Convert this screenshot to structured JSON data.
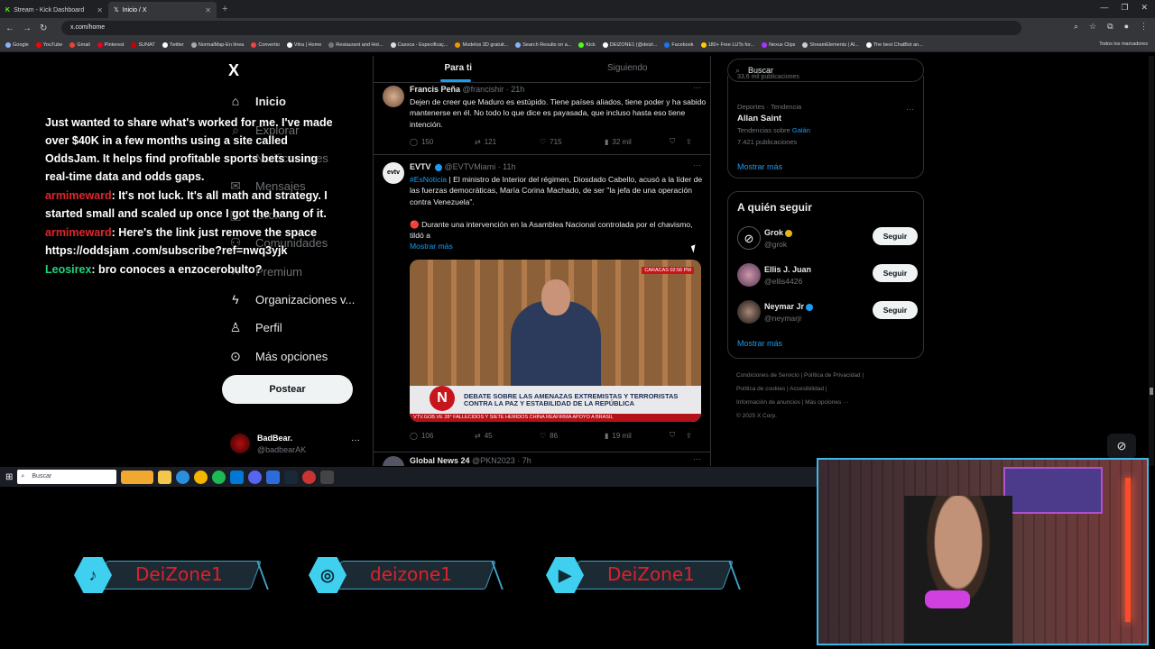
{
  "browser": {
    "tabs": [
      {
        "label": "Stream - Kick Dashboard"
      },
      {
        "label": "Inicio / X"
      }
    ],
    "url": "x.com/home",
    "bookmarks": [
      "Google",
      "YouTube",
      "Gmail",
      "Pinterest",
      "SUNAT",
      "Twitter",
      "NormalMap-En línea",
      "Convertio",
      "Vitra | Home",
      "Restaurant and Hot...",
      "Casoca - Especificaç...",
      "Modelos 3D gratuit...",
      "Search Results on a...",
      "Kick",
      "DEIZONE1 (@deizt...",
      "Facebook",
      "180+ Free LUTs for...",
      "Nexus Clips",
      "StreamElements | Al...",
      "The best ChatBot an..."
    ],
    "bookmarks_all": "Todos los marcadores"
  },
  "nav": {
    "logo": "X",
    "items": [
      {
        "label": "Inicio"
      },
      {
        "label": "Explorar"
      },
      {
        "label": "Notificaciones"
      },
      {
        "label": "Mensajes"
      },
      {
        "label": "Grok"
      },
      {
        "label": "Comunidades"
      },
      {
        "label": "Premium"
      },
      {
        "label": "Organizaciones v..."
      },
      {
        "label": "Perfil"
      },
      {
        "label": "Más opciones"
      }
    ],
    "post_button": "Postear",
    "profile": {
      "name": "BadBear.",
      "handle": "@badbearAK",
      "more": "···"
    }
  },
  "chat": {
    "intro": "Just wanted to share what's worked for me. I've made over $40K in a few months using a site called OddsJam. It helps find profitable sports bets using real-time data and odds gaps.",
    "messages": [
      {
        "user": "armimeward",
        "text": ": It's not luck. It's all math and strategy. I started small and scaled up once I got the hang of it."
      },
      {
        "user": "armimeward",
        "text": ": Here's the link just remove the space https://oddsjam .com/subscribe?ref=nwq3yjk"
      },
      {
        "user": "Leosirex",
        "text": ": bro conoces a enzocerobulto?"
      }
    ]
  },
  "feed": {
    "tabs": [
      {
        "label": "Para ti"
      },
      {
        "label": "Siguiendo"
      }
    ],
    "tweets": [
      {
        "name": "Francis Peña",
        "handle": "@francishir · 21h",
        "text": "Dejen de creer que Maduro es estúpido.  Tiene países aliados, tiene poder y ha sabido mantenerse en él. No todo lo que dice es payasada, que incluso hasta eso tiene intención.",
        "replies": "150",
        "reposts": "121",
        "likes": "715",
        "views": "32 mil"
      },
      {
        "name": "EVTV",
        "handle": "@EVTVMiami · 11h",
        "hashtag": "#EsNoticia",
        "text": " | El ministro de Interior del régimen, Diosdado Cabello, acusó a la líder de las fuerzas democráticas, María Corina Machado, de ser \"la jefa de una operación contra Venezuela\".",
        "text2": "🔴 Durante una intervención en la Asamblea Nacional controlada por el chavismo, tildó a",
        "show_more": "Mostrar más",
        "media": {
          "headline": "DEBATE SOBRE LAS AMENAZAS EXTREMISTAS Y TERRORISTAS CONTRA LA PAZ Y ESTABILIDAD DE LA REPÚBLICA",
          "ticker": "VTV.GOB.VE  28°  FALLECIDOS Y SIETE HERIDOS  CHINA REAFIRMA APOYO A BRASIL",
          "logo": "N",
          "live": "CARACAS 02:56 PM"
        },
        "replies": "106",
        "reposts": "45",
        "likes": "86",
        "views": "19 mil"
      },
      {
        "name": "Global News 24",
        "handle": "@PKN2023 · 7h"
      }
    ]
  },
  "right": {
    "search_placeholder": "Buscar",
    "trend": {
      "pre": "33,6 mil publicaciones",
      "category": "Deportes · Tendencia",
      "title": "Allan Saint",
      "sub_prefix": "Tendencias sobre ",
      "sub_link": "Galán",
      "count": "7.421 publicaciones",
      "show_more": "Mostrar más"
    },
    "who_to_follow": {
      "title": "A quién seguir",
      "accounts": [
        {
          "name": "Grok",
          "handle": "@grok",
          "button": "Seguir"
        },
        {
          "name": "Ellis J. Juan",
          "handle": "@ellis4426",
          "button": "Seguir"
        },
        {
          "name": "Neymar Jr",
          "handle": "@neymarjr",
          "button": "Seguir"
        }
      ],
      "show_more": "Mostrar más"
    },
    "footer": [
      "Condiciones de Servicio",
      "Política de Privacidad",
      "Política de cookies",
      "Accesibilidad",
      "Información de anuncios",
      "Más opciones ···",
      "© 2025 X Corp."
    ]
  },
  "taskbar": {
    "search": "Buscar"
  },
  "socials": [
    {
      "icon": "tiktok-icon",
      "label": "DeiZone1"
    },
    {
      "icon": "instagram-icon",
      "label": "deizone1"
    },
    {
      "icon": "youtube-icon",
      "label": "DeiZone1"
    }
  ],
  "colors": {
    "accent": "#1d9bf0",
    "chat_user": "#e0262b",
    "chat_user2": "#1fd57e",
    "overlay": "#3fd0f0"
  }
}
